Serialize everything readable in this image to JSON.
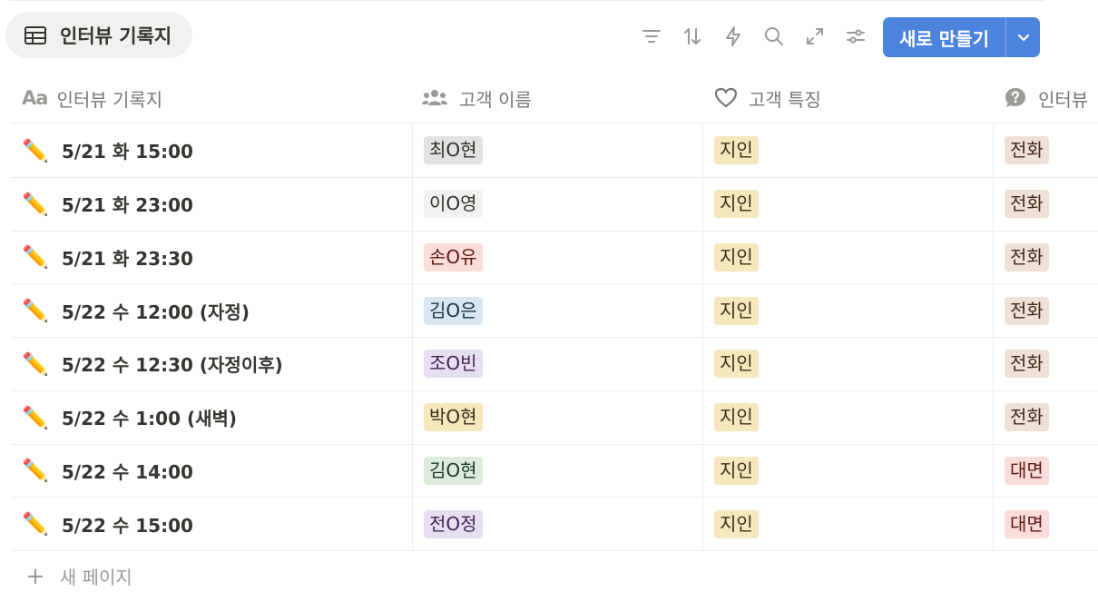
{
  "view": {
    "icon": "table-icon",
    "label": "인터뷰 기록지"
  },
  "toolbar": {
    "icons": [
      "filter-icon",
      "sort-icon",
      "automation-icon",
      "search-icon",
      "expand-icon",
      "settings-icon"
    ],
    "new_button_label": "새로 만들기",
    "new_button_color": "#4b83dd"
  },
  "columns": [
    {
      "icon": "text-type-icon",
      "icon_text": "Aa",
      "label": "인터뷰 기록지"
    },
    {
      "icon": "people-icon",
      "label": "고객 이름"
    },
    {
      "icon": "heart-icon",
      "label": "고객 특징"
    },
    {
      "icon": "question-icon",
      "label": "인터뷰"
    }
  ],
  "rows": [
    {
      "emoji": "✏️",
      "title": "5/21 화 15:00",
      "name": "최O현",
      "trait": "지인",
      "type": "전화"
    },
    {
      "emoji": "✏️",
      "title": "5/21 화 23:00",
      "name": "이O영",
      "trait": "지인",
      "type": "전화"
    },
    {
      "emoji": "✏️",
      "title": "5/21 화 23:30",
      "name": "손O유",
      "trait": "지인",
      "type": "전화"
    },
    {
      "emoji": "✏️",
      "title": "5/22 수 12:00 (자정)",
      "name": "김O은",
      "trait": "지인",
      "type": "전화"
    },
    {
      "emoji": "✏️",
      "title": "5/22 수 12:30 (자정이후)",
      "name": "조O빈",
      "trait": "지인",
      "type": "전화"
    },
    {
      "emoji": "✏️",
      "title": "5/22 수 1:00 (새벽)",
      "name": "박O현",
      "trait": "지인",
      "type": "전화"
    },
    {
      "emoji": "✏️",
      "title": "5/22 수 14:00",
      "name": "김O현",
      "trait": "지인",
      "type": "대면"
    },
    {
      "emoji": "✏️",
      "title": "5/22 수 15:00",
      "name": "전O정",
      "trait": "지인",
      "type": "대면"
    }
  ],
  "tag_colors": {
    "name": [
      "#e3e2e0",
      "#f1f1ef",
      "#fadcd8",
      "#d9e6f4",
      "#e6dff2",
      "#f6e7bc",
      "#dcebdc",
      "#e6dff2"
    ],
    "name_text": [
      "#32302c",
      "#32302c",
      "#5d1715",
      "#183347",
      "#412454",
      "#402c1b",
      "#1c3829",
      "#412454"
    ],
    "trait": "#f6e7bc",
    "trait_text": "#402c1b",
    "type": [
      "#efe0d8",
      "#efe0d8",
      "#efe0d8",
      "#efe0d8",
      "#efe0d8",
      "#efe0d8",
      "#fadcd8",
      "#fadcd8"
    ],
    "type_text": [
      "#44291b",
      "#44291b",
      "#44291b",
      "#44291b",
      "#44291b",
      "#44291b",
      "#5d1715",
      "#5d1715"
    ]
  },
  "footer": {
    "new_page_label": "새 페이지"
  }
}
